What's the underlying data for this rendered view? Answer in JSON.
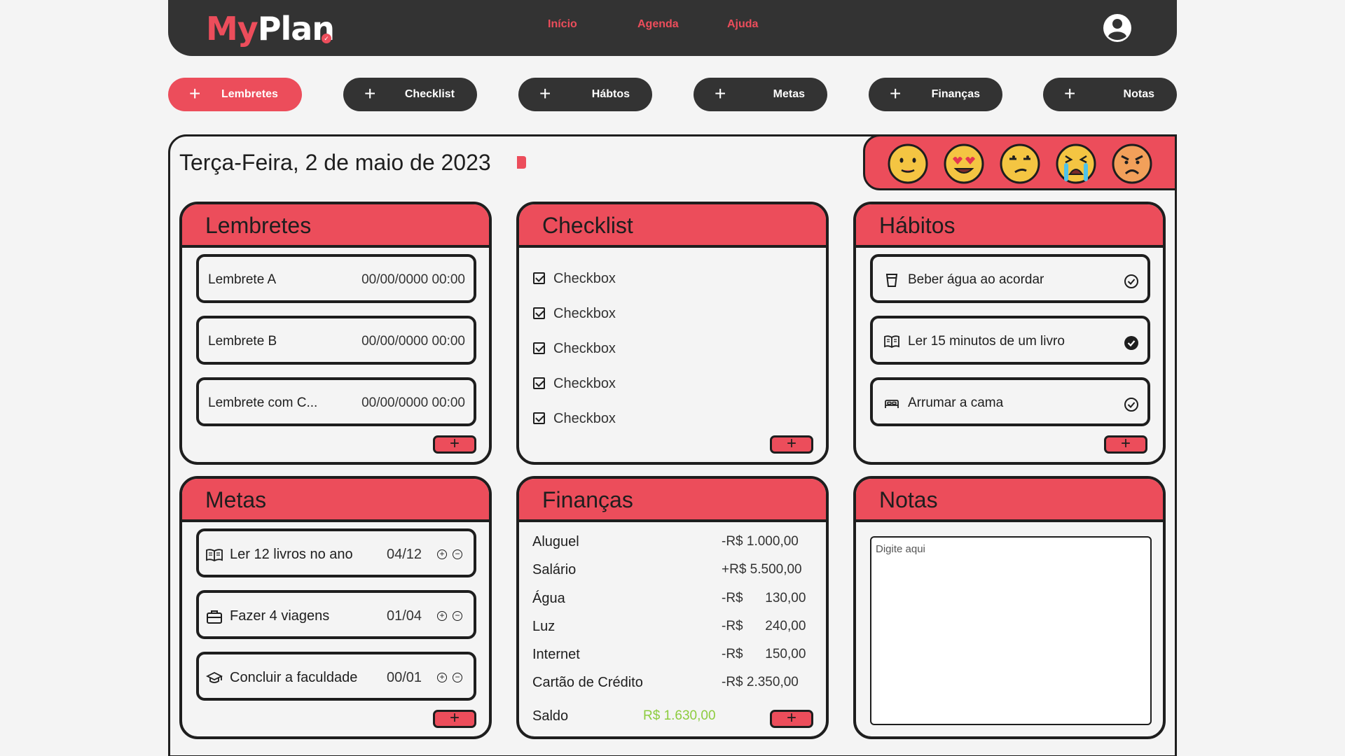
{
  "brand": {
    "my": "My",
    "plan": "Plan"
  },
  "nav": {
    "items": [
      "Início",
      "Agenda",
      "Ajuda"
    ]
  },
  "categories": [
    "Lembretes",
    "Checklist",
    "Hábtos",
    "Metas",
    "Finanças",
    "Notas"
  ],
  "date": "Terça-Feira, 2 de maio de 2023",
  "moods": [
    "neutral-face-icon",
    "heart-eyes-face-icon",
    "rolling-eyes-face-icon",
    "crying-face-icon",
    "angry-face-icon"
  ],
  "lembretes": {
    "title": "Lembretes",
    "items": [
      {
        "label": "Lembrete A",
        "when": "00/00/0000 00:00"
      },
      {
        "label": "Lembrete B",
        "when": "00/00/0000 00:00"
      },
      {
        "label": "Lembrete com C...",
        "when": "00/00/0000 00:00"
      }
    ]
  },
  "checklist": {
    "title": "Checklist",
    "items": [
      "Checkbox",
      "Checkbox",
      "Checkbox",
      "Checkbox",
      "Checkbox"
    ]
  },
  "habitos": {
    "title": "Hábitos",
    "items": [
      {
        "label": "Beber água ao acordar",
        "icon": "glass-icon",
        "done": false
      },
      {
        "label": "Ler 15 minutos de um livro",
        "icon": "book-icon",
        "done": true
      },
      {
        "label": "Arrumar a cama",
        "icon": "bed-icon",
        "done": false
      }
    ]
  },
  "metas": {
    "title": "Metas",
    "items": [
      {
        "label": "Ler 12 livros no ano",
        "progress": "04/12",
        "icon": "book-icon"
      },
      {
        "label": "Fazer 4 viagens",
        "progress": "01/04",
        "icon": "suitcase-icon"
      },
      {
        "label": "Concluir a faculdade",
        "progress": "00/01",
        "icon": "graduation-cap-icon"
      }
    ]
  },
  "financas": {
    "title": "Finanças",
    "rows": [
      {
        "label": "Aluguel",
        "value": "-R$ 1.000,00"
      },
      {
        "label": "Salário",
        "value": "+R$ 5.500,00"
      },
      {
        "label": "Água",
        "value": "-R$      130,00"
      },
      {
        "label": "Luz",
        "value": "-R$      240,00"
      },
      {
        "label": "Internet",
        "value": "-R$      150,00"
      },
      {
        "label": "Cartão de Crédito",
        "value": "-R$ 2.350,00"
      }
    ],
    "saldo_label": "Saldo",
    "saldo_value": "R$ 1.630,00"
  },
  "notas": {
    "title": "Notas",
    "placeholder": "Digite aqui"
  },
  "colors": {
    "accent": "#ec4d5b",
    "dark": "#333333",
    "positive": "#8dcc3f",
    "background": "#f4f4f4"
  }
}
